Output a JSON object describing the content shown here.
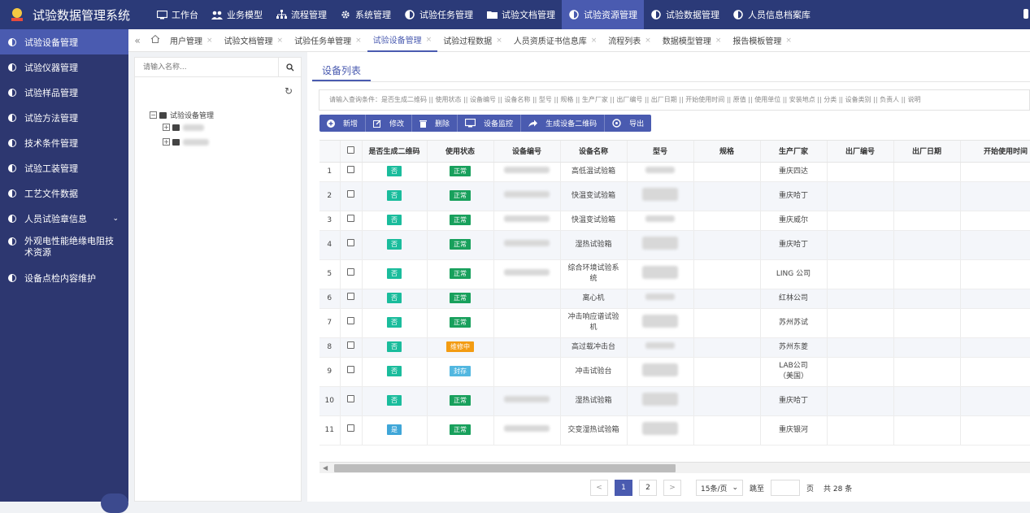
{
  "app": {
    "title": "试验数据管理系统"
  },
  "topnav": [
    {
      "label": "工作台",
      "icon": "monitor-icon",
      "active": false
    },
    {
      "label": "业务模型",
      "icon": "users-icon",
      "active": false
    },
    {
      "label": "流程管理",
      "icon": "sitemap-icon",
      "active": false
    },
    {
      "label": "系统管理",
      "icon": "gear-icon",
      "active": false
    },
    {
      "label": "试验任务管理",
      "icon": "half-circle-icon",
      "active": false
    },
    {
      "label": "试验文档管理",
      "icon": "folder-icon",
      "active": false
    },
    {
      "label": "试验资源管理",
      "icon": "half-circle-icon",
      "active": true
    },
    {
      "label": "试验数据管理",
      "icon": "half-circle-icon",
      "active": false
    },
    {
      "label": "人员信息档案库",
      "icon": "half-circle-icon",
      "active": false
    }
  ],
  "sidebar": [
    {
      "label": "试验设备管理",
      "active": true
    },
    {
      "label": "试验仪器管理"
    },
    {
      "label": "试验样品管理"
    },
    {
      "label": "试验方法管理"
    },
    {
      "label": "技术条件管理"
    },
    {
      "label": "试验工装管理"
    },
    {
      "label": "工艺文件数据"
    },
    {
      "label": "人员试验章信息",
      "has_submenu": true
    },
    {
      "label": "外观电性能绝缘电阻技术资源",
      "tall": true
    },
    {
      "label": "设备点检内容维护"
    }
  ],
  "tabs": [
    {
      "label": "用户管理"
    },
    {
      "label": "试验文档管理"
    },
    {
      "label": "试验任务单管理"
    },
    {
      "label": "试验设备管理",
      "active": true
    },
    {
      "label": "试验过程数据"
    },
    {
      "label": "人员资质证书信息库"
    },
    {
      "label": "流程列表"
    },
    {
      "label": "数据模型管理"
    },
    {
      "label": "报告模板管理"
    }
  ],
  "tree": {
    "search_placeholder": "请输入名称...",
    "root_label": "试验设备管理"
  },
  "main": {
    "section_tab": "设备列表",
    "query_text": "请输入查询条件：是否生成二维码 || 使用状态 || 设备编号 || 设备名称 || 型号 || 规格 || 生产厂家 || 出厂编号 || 出厂日期 || 开始使用时间 || 原值 || 使用单位 || 安装地点 || 分类 || 设备类别 || 负责人 || 说明"
  },
  "toolbar": [
    {
      "label": "新增",
      "icon": "plus-icon"
    },
    {
      "label": "修改",
      "icon": "edit-icon"
    },
    {
      "label": "删除",
      "icon": "trash-icon"
    },
    {
      "label": "设备监控",
      "icon": "monitor-icon"
    },
    {
      "label": "生成设备二维码",
      "icon": "share-icon"
    },
    {
      "label": "导出",
      "icon": "export-icon"
    }
  ],
  "table": {
    "columns": [
      "是否生成二维码",
      "使用状态",
      "设备编号",
      "设备名称",
      "型号",
      "规格",
      "生产厂家",
      "出厂编号",
      "出厂日期",
      "开始使用时间"
    ],
    "rows": [
      {
        "no": "1",
        "qr": "否",
        "status": "正常",
        "name": "高低温试验箱",
        "vendor": "重庆四达",
        "has_code": true
      },
      {
        "no": "2",
        "qr": "否",
        "status": "正常",
        "name": "快温变试验箱",
        "vendor": "重庆哈丁",
        "has_code": true
      },
      {
        "no": "3",
        "qr": "否",
        "status": "正常",
        "name": "快温变试验箱",
        "vendor": "重庆威尔",
        "has_code": true
      },
      {
        "no": "4",
        "qr": "否",
        "status": "正常",
        "name": "湿热试验箱",
        "vendor": "重庆哈丁",
        "has_code": true
      },
      {
        "no": "5",
        "qr": "否",
        "status": "正常",
        "name": "综合环境试验系统",
        "vendor": "LING 公司",
        "has_code": true
      },
      {
        "no": "6",
        "qr": "否",
        "status": "正常",
        "name": "离心机",
        "vendor": "红林公司",
        "has_code": false
      },
      {
        "no": "7",
        "qr": "否",
        "status": "正常",
        "name": "冲击响应谱试验机",
        "vendor": "苏州苏试",
        "has_code": false
      },
      {
        "no": "8",
        "qr": "否",
        "status": "维修中",
        "name": "高过载冲击台",
        "vendor": "苏州东菱",
        "has_code": false
      },
      {
        "no": "9",
        "qr": "否",
        "status": "封存",
        "name": "冲击试验台",
        "vendor": "LAB公司 （美国）",
        "has_code": false
      },
      {
        "no": "10",
        "qr": "否",
        "status": "正常",
        "name": "湿热试验箱",
        "vendor": "重庆哈丁",
        "has_code": true
      },
      {
        "no": "11",
        "qr": "是",
        "status": "正常",
        "name": "交变湿热试验箱",
        "vendor": "重庆银河",
        "has_code": true
      }
    ]
  },
  "pagination": {
    "prev": "<",
    "next": ">",
    "pages": [
      "1",
      "2"
    ],
    "current": "1",
    "page_size": "15条/页",
    "jump_label": "跳至",
    "page_unit": "页",
    "total": "共 28 条"
  },
  "colors": {
    "topbar": "#2b3a78",
    "sidebar": "#2d3770",
    "accent": "#4a5bb0",
    "badge_no": "#1abc9c",
    "badge_normal": "#18a05c",
    "badge_repair": "#f39c12",
    "badge_sealed": "#52b7e0",
    "badge_yes": "#3fa6d8"
  }
}
